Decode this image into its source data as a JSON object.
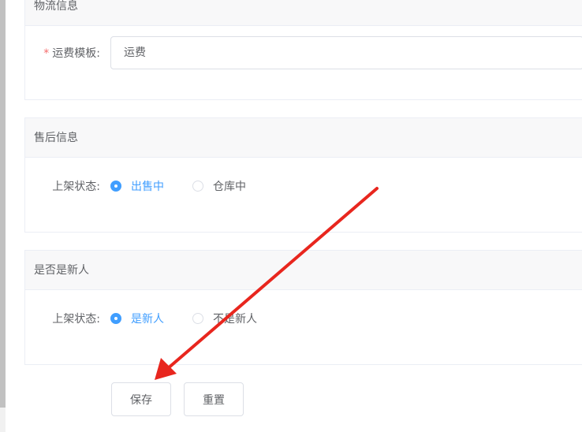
{
  "logistics": {
    "title": "物流信息",
    "required_mark": "*",
    "label": "运费模板:",
    "value": "运费"
  },
  "after_sale": {
    "title": "售后信息",
    "label": "上架状态:",
    "options": [
      "出售中",
      "仓库中"
    ],
    "selected": 0
  },
  "new_user": {
    "title": "是否是新人",
    "label": "上架状态:",
    "options": [
      "是新人",
      "不是新人"
    ],
    "selected": 0
  },
  "buttons": {
    "save": "保存",
    "reset": "重置"
  },
  "annotation": {
    "arrow_color": "#e8261e"
  }
}
